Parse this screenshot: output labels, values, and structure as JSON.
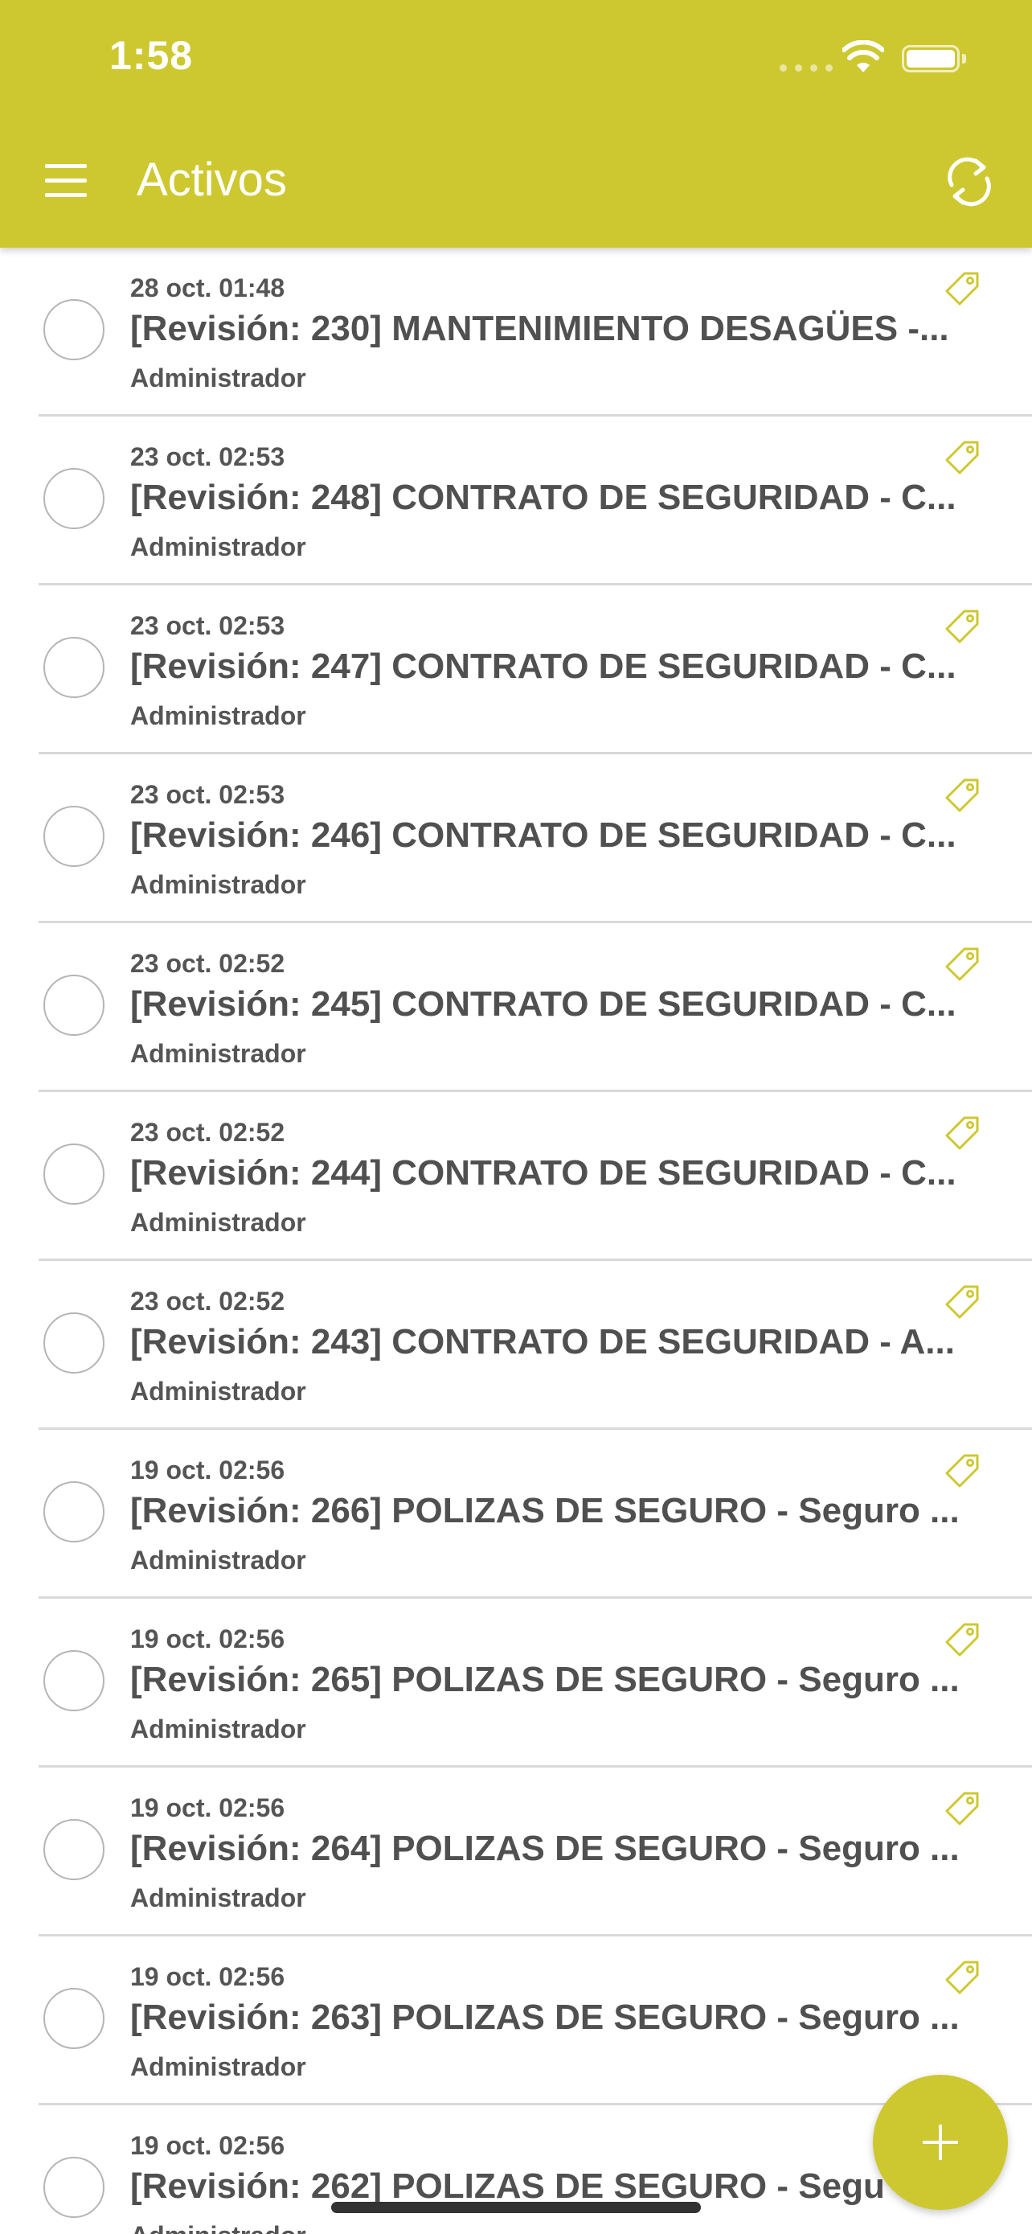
{
  "status_bar": {
    "time": "1:58"
  },
  "header": {
    "title": "Activos"
  },
  "items": [
    {
      "date": "28 oct. 01:48",
      "title": "[Revisión: 230] MANTENIMIENTO DESAGÜES -...",
      "author": "Administrador"
    },
    {
      "date": "23 oct. 02:53",
      "title": "[Revisión: 248] CONTRATO DE SEGURIDAD - C...",
      "author": "Administrador"
    },
    {
      "date": "23 oct. 02:53",
      "title": "[Revisión: 247] CONTRATO DE SEGURIDAD - C...",
      "author": "Administrador"
    },
    {
      "date": "23 oct. 02:53",
      "title": "[Revisión: 246] CONTRATO DE SEGURIDAD - C...",
      "author": "Administrador"
    },
    {
      "date": "23 oct. 02:52",
      "title": "[Revisión: 245] CONTRATO DE SEGURIDAD - C...",
      "author": "Administrador"
    },
    {
      "date": "23 oct. 02:52",
      "title": "[Revisión: 244] CONTRATO DE SEGURIDAD - C...",
      "author": "Administrador"
    },
    {
      "date": "23 oct. 02:52",
      "title": "[Revisión: 243] CONTRATO DE SEGURIDAD - A...",
      "author": "Administrador"
    },
    {
      "date": "19 oct. 02:56",
      "title": "[Revisión: 266] POLIZAS DE SEGURO - Seguro ...",
      "author": "Administrador"
    },
    {
      "date": "19 oct. 02:56",
      "title": "[Revisión: 265] POLIZAS DE SEGURO - Seguro ...",
      "author": "Administrador"
    },
    {
      "date": "19 oct. 02:56",
      "title": "[Revisión: 264] POLIZAS DE SEGURO - Seguro ...",
      "author": "Administrador"
    },
    {
      "date": "19 oct. 02:56",
      "title": "[Revisión: 263] POLIZAS DE SEGURO - Seguro ...",
      "author": "Administrador"
    },
    {
      "date": "19 oct. 02:56",
      "title": "[Revisión: 262] POLIZAS DE SEGURO - Segu",
      "author": "Administrador"
    }
  ],
  "colors": {
    "accent": "#cdc830",
    "text": "#505050",
    "divider": "#d9d9d9"
  },
  "icons": {
    "menu": "hamburger-menu-icon",
    "refresh": "refresh-icon",
    "tag": "tag-icon",
    "add": "plus-icon"
  }
}
